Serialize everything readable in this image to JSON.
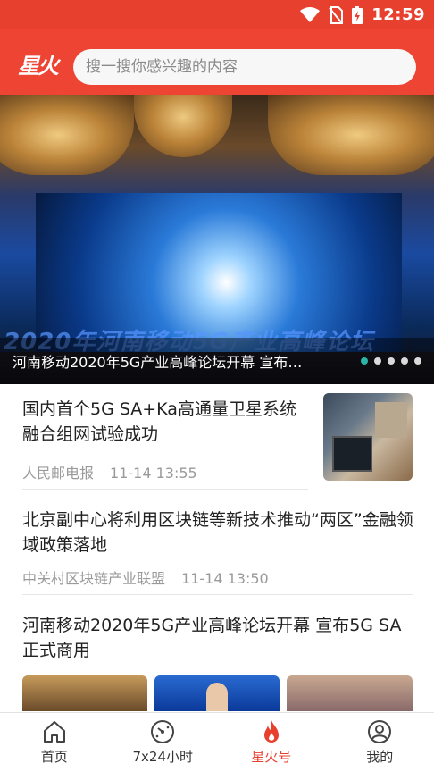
{
  "status_bar": {
    "time": "12:59"
  },
  "header": {
    "logo_text": "星火",
    "search_placeholder": "搜一搜你感兴趣的内容"
  },
  "banner": {
    "caption": "河南移动2020年5G产业高峰论坛开幕 宣布…",
    "stage_text": "2020年河南移动5G产业高峰论坛",
    "slide_count": 5,
    "active_slide": 1
  },
  "news": [
    {
      "title": "国内首个5G SA+Ka高通量卫星系统融合组网试验成功",
      "source": "人民邮电报",
      "time": "11-14 13:55"
    },
    {
      "title": "北京副中心将利用区块链等新技术推动“两区”金融领域政策落地",
      "source": "中关村区块链产业联盟",
      "time": "11-14 13:50"
    },
    {
      "title": "河南移动2020年5G产业高峰论坛开幕 宣布5G SA正式商用"
    }
  ],
  "tabs": [
    {
      "label": "首页",
      "icon": "home-icon"
    },
    {
      "label": "7x24小时",
      "icon": "clock-icon"
    },
    {
      "label": "星火号",
      "icon": "flame-icon",
      "active": true
    },
    {
      "label": "我的",
      "icon": "user-icon"
    }
  ],
  "colors": {
    "brand": "#e8402f",
    "active_dot": "#2bb5a8"
  }
}
